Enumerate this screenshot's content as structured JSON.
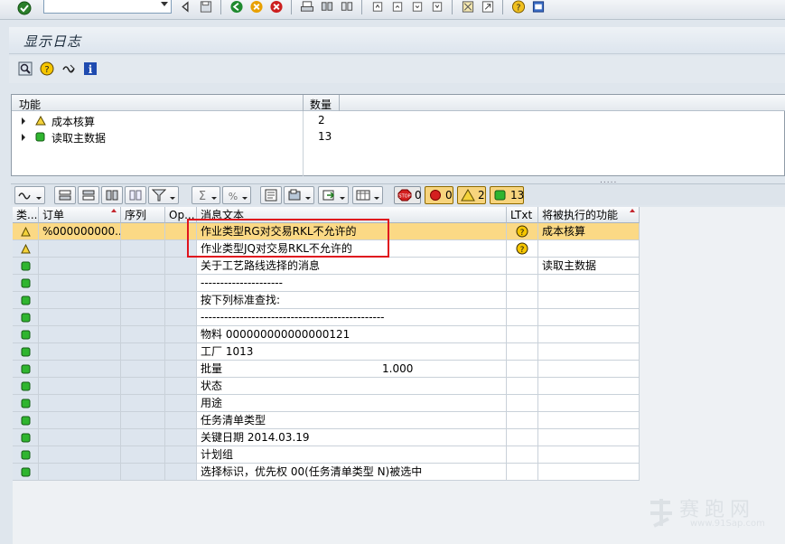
{
  "toolbar": {
    "command_placeholder": ""
  },
  "title": "显示日志",
  "tree": {
    "headers": {
      "function": "功能",
      "count": "数量"
    },
    "rows": [
      {
        "label": "成本核算",
        "count": "2",
        "status": "warning"
      },
      {
        "label": "读取主数据",
        "count": "13",
        "status": "success"
      }
    ]
  },
  "alv_toolbar": {
    "counters": {
      "stop": "0",
      "error": "0",
      "warning": "2",
      "success": "13"
    }
  },
  "grid": {
    "headers": {
      "type": "类...",
      "order": "订单",
      "seq": "序列",
      "op": "Op...",
      "message": "消息文本",
      "ltxt": "LTxt",
      "func": "将被执行的功能"
    },
    "rows": [
      {
        "status": "warning",
        "order": "%000000000...",
        "seq": "",
        "op": "",
        "message": "作业类型RG对交易RKL不允许的",
        "ltxt": true,
        "func": "成本核算"
      },
      {
        "status": "warning",
        "order": "",
        "seq": "",
        "op": "",
        "message": "作业类型JQ对交易RKL不允许的",
        "ltxt": true,
        "func": ""
      },
      {
        "status": "success",
        "order": "",
        "seq": "",
        "op": "",
        "message": "关于工艺路线选择的消息",
        "ltxt": false,
        "func": "读取主数据"
      },
      {
        "status": "success",
        "order": "",
        "seq": "",
        "op": "",
        "message": "---------------------",
        "ltxt": false,
        "func": ""
      },
      {
        "status": "success",
        "order": "",
        "seq": "",
        "op": "",
        "message": "按下列标准查找:",
        "ltxt": false,
        "func": ""
      },
      {
        "status": "success",
        "order": "",
        "seq": "",
        "op": "",
        "message": "-----------------------------------------------",
        "ltxt": false,
        "func": ""
      },
      {
        "status": "success",
        "order": "",
        "seq": "",
        "op": "",
        "message": "物料 000000000000000121",
        "ltxt": false,
        "func": ""
      },
      {
        "status": "success",
        "order": "",
        "seq": "",
        "op": "",
        "message": "工厂 1013",
        "ltxt": false,
        "func": ""
      },
      {
        "status": "success",
        "order": "",
        "seq": "",
        "op": "",
        "message": "批量",
        "value": "1.000",
        "ltxt": false,
        "func": ""
      },
      {
        "status": "success",
        "order": "",
        "seq": "",
        "op": "",
        "message": "状态",
        "ltxt": false,
        "func": ""
      },
      {
        "status": "success",
        "order": "",
        "seq": "",
        "op": "",
        "message": "用途",
        "ltxt": false,
        "func": ""
      },
      {
        "status": "success",
        "order": "",
        "seq": "",
        "op": "",
        "message": "任务清单类型",
        "ltxt": false,
        "func": ""
      },
      {
        "status": "success",
        "order": "",
        "seq": "",
        "op": "",
        "message": "关键日期 2014.03.19",
        "ltxt": false,
        "func": ""
      },
      {
        "status": "success",
        "order": "",
        "seq": "",
        "op": "",
        "message": "计划组",
        "ltxt": false,
        "func": ""
      },
      {
        "status": "success",
        "order": "",
        "seq": "",
        "op": "",
        "message": "选择标识，优先权 00(任务清单类型 N)被选中",
        "ltxt": false,
        "func": ""
      }
    ]
  },
  "watermark": {
    "text": "赛跑网",
    "url": "www.91Sap.com"
  },
  "colors": {
    "selected_row": "#fbd985",
    "warning": "#f4d23a",
    "success": "#2fb52f",
    "highlight_box": "#e0141e"
  }
}
